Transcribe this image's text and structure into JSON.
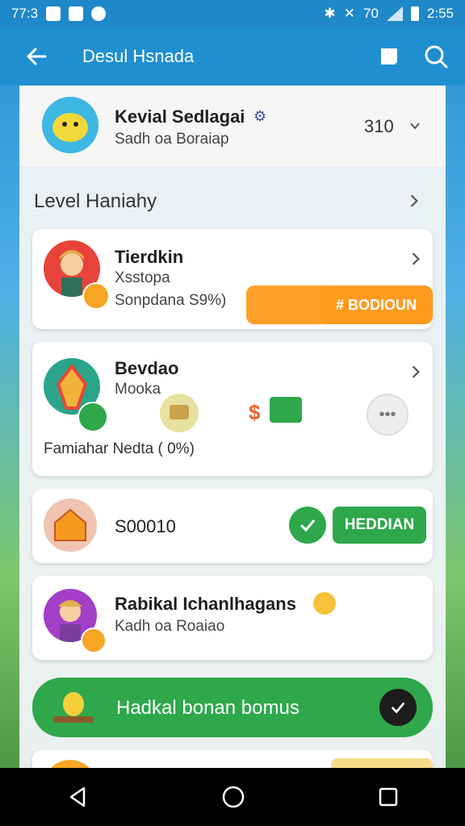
{
  "status": {
    "time_left": "77:3",
    "signal_text": "70",
    "time_right": "2:55"
  },
  "appbar": {
    "title": "Desul Hsnada"
  },
  "profile": {
    "name": "Kevial Sedlagai",
    "subtitle": "Sadh oa Boraiap",
    "points": "310"
  },
  "section": {
    "title": "Level Haniahy"
  },
  "cards": [
    {
      "name": "Tierdkin",
      "sub1": "Xsstopa",
      "sub2": "Sonpdana S9%)",
      "button": "# BODIOUN"
    },
    {
      "name": "Bevdao",
      "sub1": "Mooka",
      "progress": "Famiahar Nedta ( 0%)"
    },
    {
      "name": "S00010",
      "button": "HEDDIAN"
    },
    {
      "name": "Rabikal Ichanlhagans",
      "sub1": "Kadh oa Roaiao"
    }
  ],
  "bonus": {
    "label": "Hadkal bonan bomus"
  },
  "colors": {
    "primary": "#1f8fd0",
    "accent_orange": "#ff9a1f",
    "accent_green": "#2ea84a"
  }
}
